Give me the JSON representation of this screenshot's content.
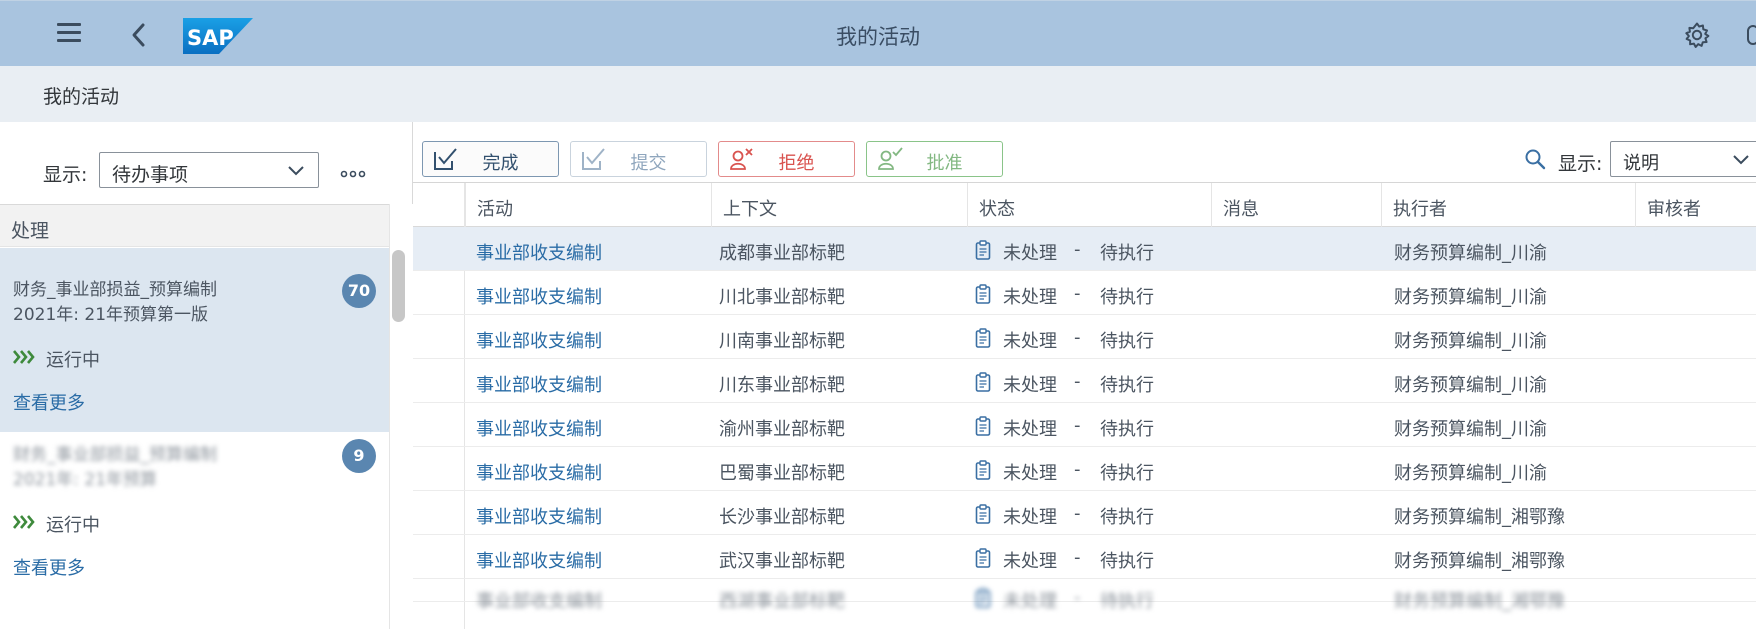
{
  "shell": {
    "title": "我的活动",
    "logo_text": "SAP"
  },
  "subheader": {
    "page_name": "我的活动"
  },
  "master": {
    "filter_label": "显示:",
    "filter_value": "待办事项",
    "group_header": "处理",
    "cards": [
      {
        "title": "财务_事业部损益_预算编制",
        "subtitle": "2021年: 21年预算第一版",
        "badge": "70",
        "status": "运行中",
        "see_more": "查看更多"
      },
      {
        "title": "财务_事业部损益_预算编制",
        "subtitle": "2021年: 21年预算",
        "badge": "9",
        "status": "运行中",
        "see_more": "查看更多"
      }
    ]
  },
  "toolbar": {
    "complete": "完成",
    "submit": "提交",
    "reject": "拒绝",
    "approve": "批准",
    "show_label": "显示:",
    "show_value": "说明"
  },
  "table": {
    "columns": [
      "活动",
      "上下文",
      "状态",
      "消息",
      "执行者",
      "审核者"
    ],
    "rows": [
      {
        "activity": "事业部收支编制",
        "context": "成都事业部标靶",
        "status": "未处理",
        "sep": "-",
        "substatus": "待执行",
        "executor": "财务预算编制_川渝"
      },
      {
        "activity": "事业部收支编制",
        "context": "川北事业部标靶",
        "status": "未处理",
        "sep": "-",
        "substatus": "待执行",
        "executor": "财务预算编制_川渝"
      },
      {
        "activity": "事业部收支编制",
        "context": "川南事业部标靶",
        "status": "未处理",
        "sep": "-",
        "substatus": "待执行",
        "executor": "财务预算编制_川渝"
      },
      {
        "activity": "事业部收支编制",
        "context": "川东事业部标靶",
        "status": "未处理",
        "sep": "-",
        "substatus": "待执行",
        "executor": "财务预算编制_川渝"
      },
      {
        "activity": "事业部收支编制",
        "context": "渝州事业部标靶",
        "status": "未处理",
        "sep": "-",
        "substatus": "待执行",
        "executor": "财务预算编制_川渝"
      },
      {
        "activity": "事业部收支编制",
        "context": "巴蜀事业部标靶",
        "status": "未处理",
        "sep": "-",
        "substatus": "待执行",
        "executor": "财务预算编制_川渝"
      },
      {
        "activity": "事业部收支编制",
        "context": "长沙事业部标靶",
        "status": "未处理",
        "sep": "-",
        "substatus": "待执行",
        "executor": "财务预算编制_湘鄂豫"
      },
      {
        "activity": "事业部收支编制",
        "context": "武汉事业部标靶",
        "status": "未处理",
        "sep": "-",
        "substatus": "待执行",
        "executor": "财务预算编制_湘鄂豫"
      },
      {
        "activity": "事业部收支编制",
        "context": "西湖事业部标靶",
        "status": "未处理",
        "sep": "-",
        "substatus": "待执行",
        "executor": "财务预算编制_湘鄂豫"
      }
    ]
  },
  "colors": {
    "shell_bg": "#a9c4df",
    "link": "#2a6ca6",
    "badge": "#5a86b0",
    "reject": "#d9534f",
    "approve": "#83b882",
    "running": "#3e8a3c"
  }
}
